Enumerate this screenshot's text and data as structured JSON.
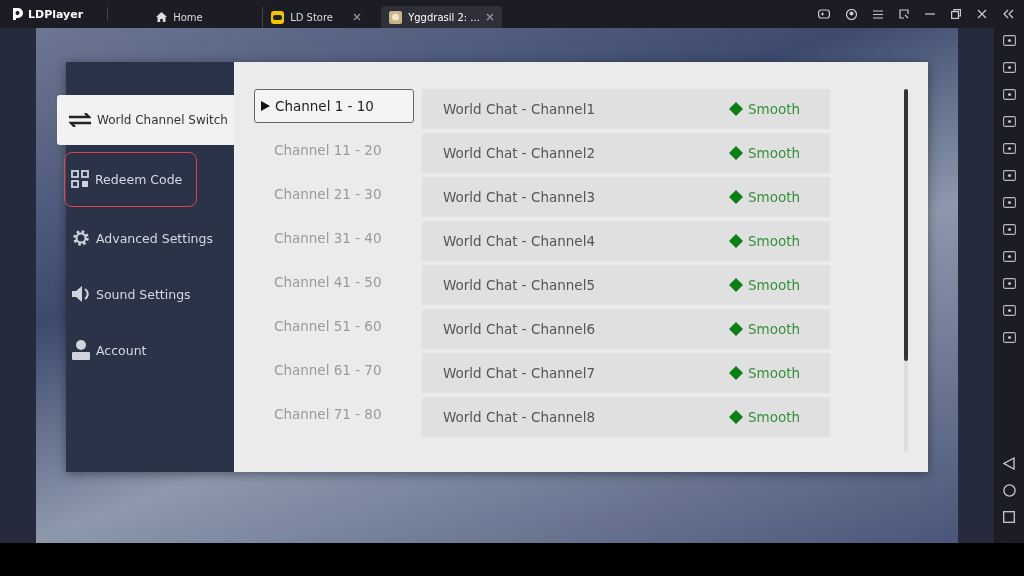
{
  "app": {
    "name": "LDPlayer"
  },
  "tabs": [
    {
      "label": "Home",
      "selected": false,
      "closable": false
    },
    {
      "label": "LD Store",
      "selected": false,
      "closable": true
    },
    {
      "label": "Yggdrasil 2: ...",
      "selected": true,
      "closable": true
    }
  ],
  "sidebar": {
    "items": [
      {
        "label": "World Channel Switch",
        "selected": true,
        "highlighted": false
      },
      {
        "label": "Redeem Code",
        "selected": false,
        "highlighted": true
      },
      {
        "label": "Advanced Settings",
        "selected": false,
        "highlighted": false
      },
      {
        "label": "Sound Settings",
        "selected": false,
        "highlighted": false
      },
      {
        "label": "Account",
        "selected": false,
        "highlighted": false
      }
    ]
  },
  "channel_ranges": [
    {
      "label": "Channel 1 - 10",
      "selected": true
    },
    {
      "label": "Channel 11 - 20",
      "selected": false
    },
    {
      "label": "Channel 21 - 30",
      "selected": false
    },
    {
      "label": "Channel 31 - 40",
      "selected": false
    },
    {
      "label": "Channel 41 - 50",
      "selected": false
    },
    {
      "label": "Channel 51 - 60",
      "selected": false
    },
    {
      "label": "Channel 61 - 70",
      "selected": false
    },
    {
      "label": "Channel 71 - 80",
      "selected": false
    }
  ],
  "channels": [
    {
      "name": "World Chat - Channel1",
      "status": "Smooth",
      "color": "#0a7d14"
    },
    {
      "name": "World Chat - Channel2",
      "status": "Smooth",
      "color": "#0a7d14"
    },
    {
      "name": "World Chat - Channel3",
      "status": "Smooth",
      "color": "#0a7d14"
    },
    {
      "name": "World Chat - Channel4",
      "status": "Smooth",
      "color": "#0a7d14"
    },
    {
      "name": "World Chat - Channel5",
      "status": "Smooth",
      "color": "#0a7d14"
    },
    {
      "name": "World Chat - Channel6",
      "status": "Smooth",
      "color": "#0a7d14"
    },
    {
      "name": "World Chat - Channel7",
      "status": "Smooth",
      "color": "#0a7d14"
    },
    {
      "name": "World Chat - Channel8",
      "status": "Smooth",
      "color": "#0a7d14"
    }
  ]
}
